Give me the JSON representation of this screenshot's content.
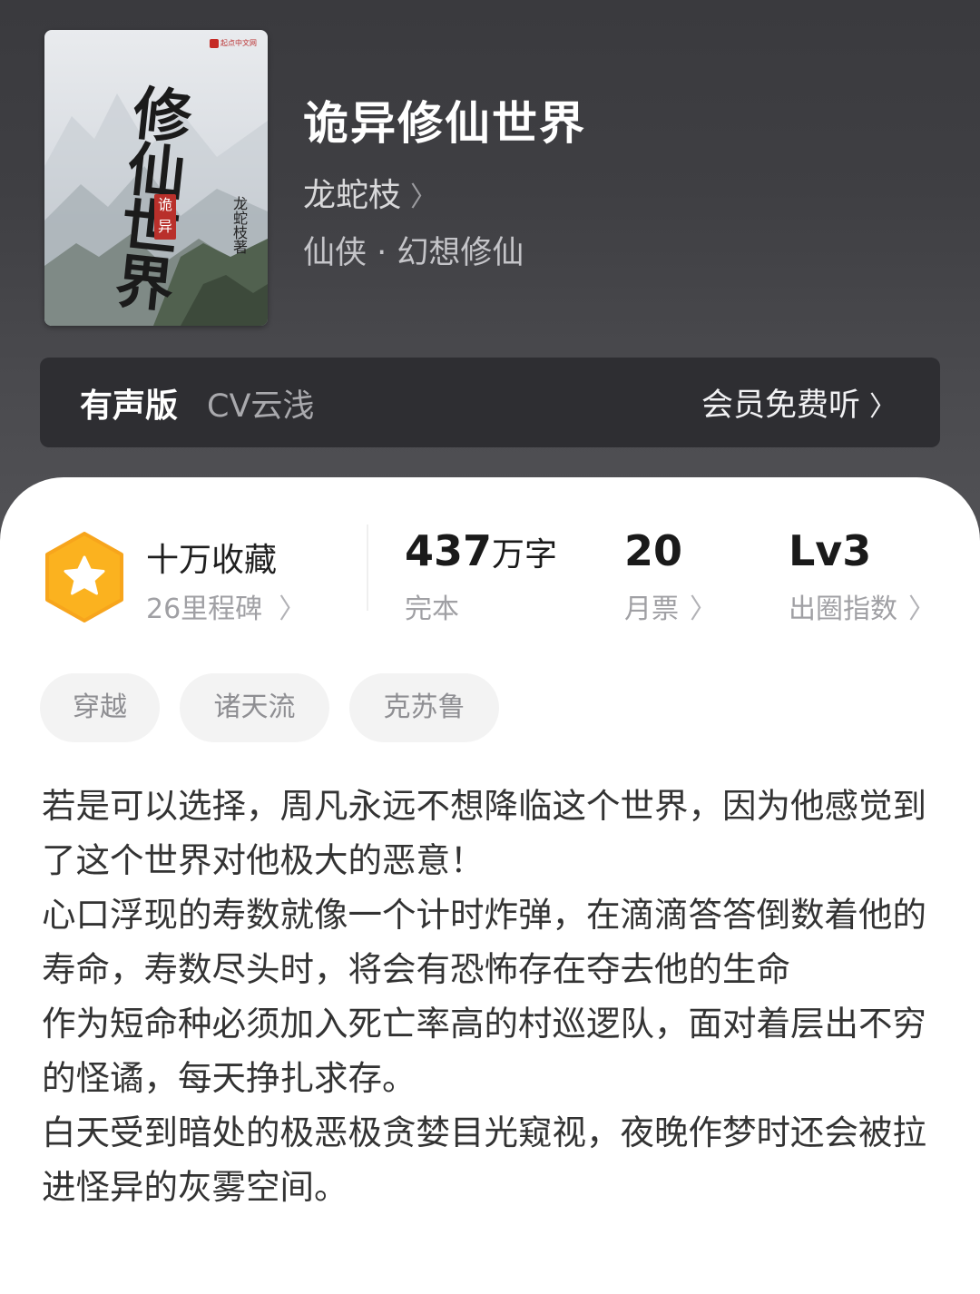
{
  "book": {
    "title": "诡异修仙世界",
    "author": "龙蛇枝",
    "genre": "仙侠 · 幻想修仙",
    "cover": {
      "calligraphy": [
        "修",
        "仙",
        "世",
        "界"
      ],
      "seal": [
        "诡",
        "异"
      ],
      "author_vertical": [
        "龙",
        "蛇",
        "枝",
        "著"
      ],
      "publisher": "起点中文网"
    }
  },
  "audio": {
    "label": "有声版",
    "cv": "CV云浅",
    "cta": "会员免费听"
  },
  "stats": {
    "favorites": {
      "main": "十万收藏",
      "sub": "26里程碑"
    },
    "words": {
      "value": "437",
      "unit": "万字",
      "label": "完本"
    },
    "tickets": {
      "value": "20",
      "label": "月票"
    },
    "index": {
      "value": "Lv3",
      "label": "出圈指数"
    }
  },
  "tags": [
    "穿越",
    "诸天流",
    "克苏鲁"
  ],
  "description": [
    "若是可以选择，周凡永远不想降临这个世界，因为他感觉到了这个世界对他极大的恶意！",
    "心口浮现的寿数就像一个计时炸弹，在滴滴答答倒数着他的寿命，寿数尽头时，将会有恐怖存在夺去他的生命",
    "作为短命种必须加入死亡率高的村巡逻队，面对着层出不穷的怪谲，每天挣扎求存。",
    "白天受到暗处的极恶极贪婪目光窥视，夜晚作梦时还会被拉进怪异的灰雾空间。"
  ],
  "colors": {
    "header_bg": "#3f3f43",
    "badge_orange": "#fbb21f",
    "badge_edge": "#f7a51c"
  },
  "icons": {
    "chevron": "chevron-right-icon",
    "badge": "star-hexagon-icon"
  }
}
